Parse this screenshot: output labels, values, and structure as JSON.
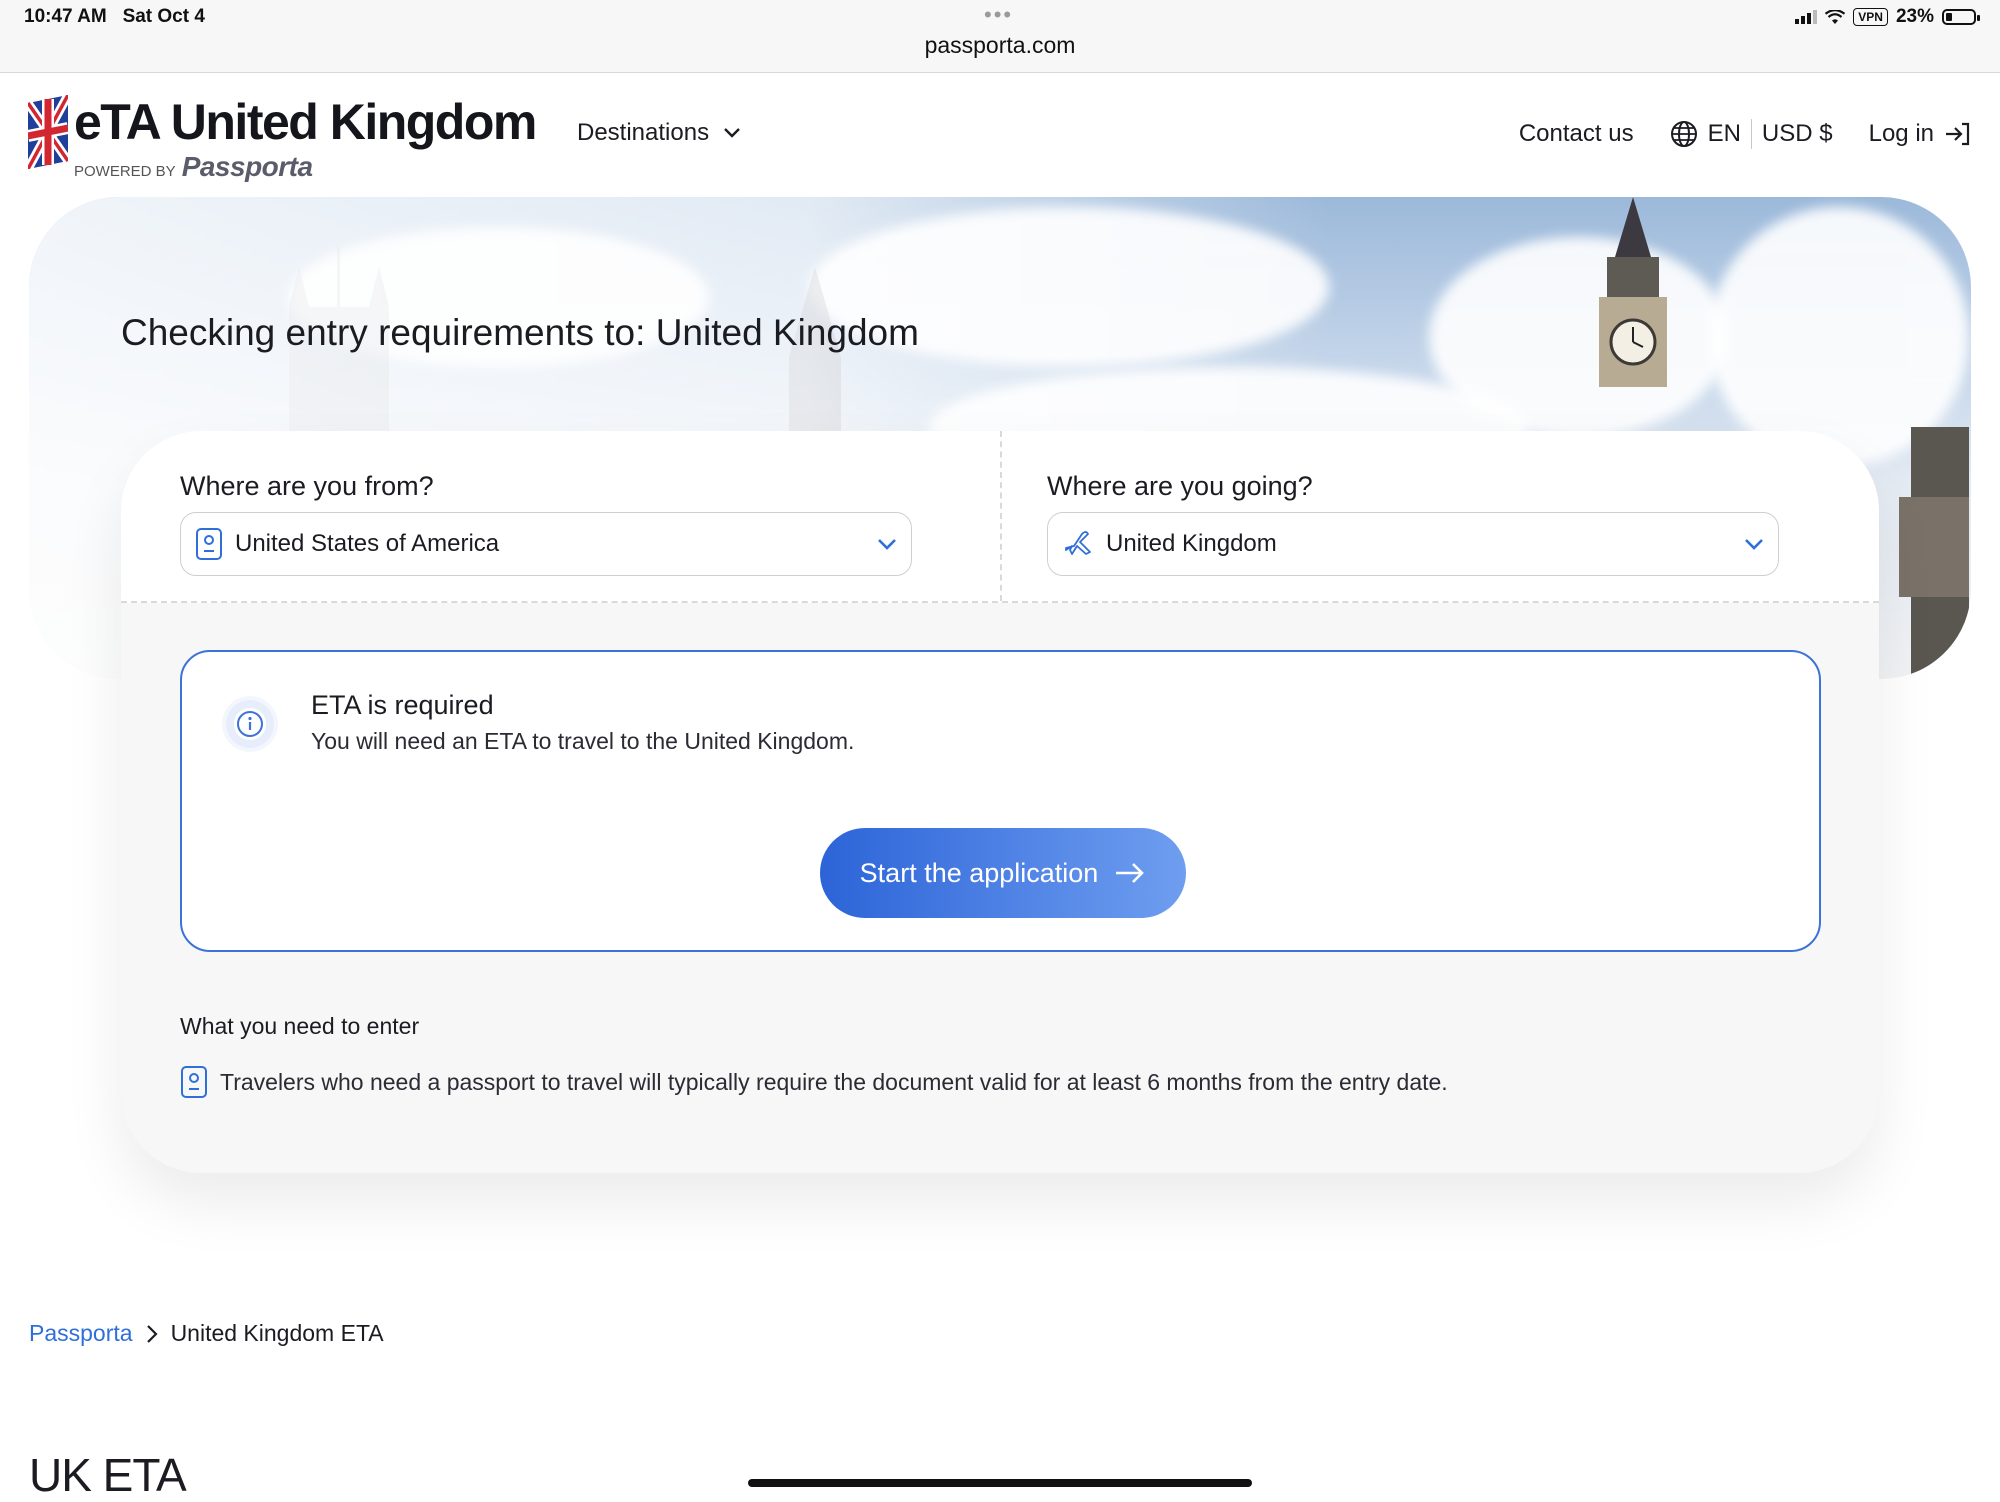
{
  "status_bar": {
    "time": "10:47 AM",
    "date": "Sat Oct 4",
    "url": "passporta.com",
    "vpn": "VPN",
    "battery": "23%"
  },
  "header": {
    "logo_title": "eTA United Kingdom",
    "logo_powered": "POWERED BY",
    "logo_brand": "Passporta",
    "nav_destinations": "Destinations",
    "contact": "Contact us",
    "language": "EN",
    "currency": "USD $",
    "login": "Log in"
  },
  "hero": {
    "title": "Checking entry requirements to: United Kingdom"
  },
  "form": {
    "from_label": "Where are you from?",
    "from_value": "United States of America",
    "to_label": "Where are you going?",
    "to_value": "United Kingdom"
  },
  "eta": {
    "title": "ETA is required",
    "text": "You will need an ETA to travel to the United Kingdom.",
    "button": "Start the application"
  },
  "requirements": {
    "title": "What you need to enter",
    "item": "Travelers who need a passport to travel will typically require the document valid for at least 6 months from the entry date."
  },
  "breadcrumb": {
    "home": "Passporta",
    "current": "United Kingdom ETA"
  },
  "section_heading": "UK ETA",
  "colors": {
    "accent": "#2f6fd9",
    "button_start": "#2c64d8",
    "button_end": "#6f9ef0"
  }
}
